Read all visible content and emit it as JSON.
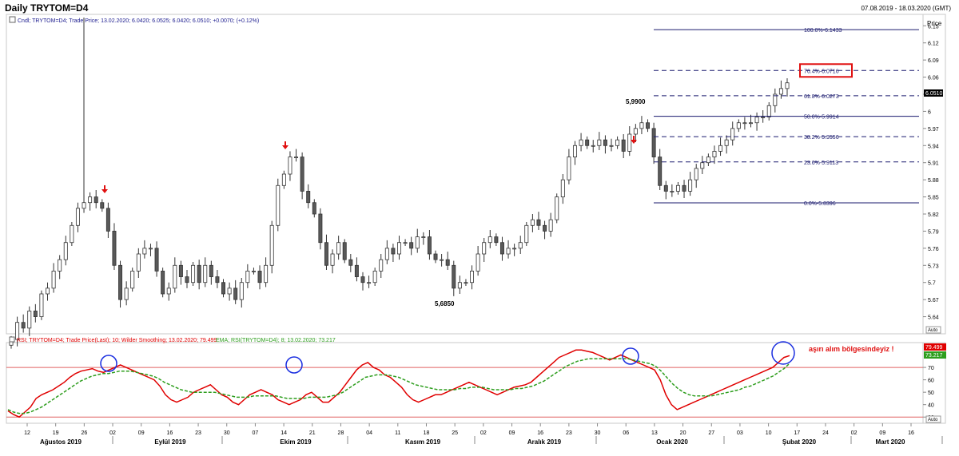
{
  "header": {
    "title": "Daily TRYTOM=D4",
    "date_range": "07.08.2019 - 18.03.2020 (GMT)"
  },
  "price_panel": {
    "legend": "Cndl; TRYTOM=D4; Trade Price; 13.02.2020; 6.0420; 6.0525; 6.0420; 6.0510; +0.0070; (+0.12%)",
    "axis_title": "Price",
    "last_price_tag": "6.0510",
    "auto_button": "Auto"
  },
  "rsi_panel": {
    "legend_rsi": "RSI; TRYTOM=D4; Trade Price(Last); 10; Wilder Smoothing; 13.02.2020; 79.499",
    "legend_ema": "EMA; RSI(TRYTOM=D4); 8; 13.02.2020; 73.217",
    "annotation": "aşırı alım bölgesindeyiz !",
    "rsi_tag": "79.499",
    "ema_tag": "73.217",
    "auto_button": "Auto"
  },
  "colors": {
    "up": "#ffffff",
    "down": "#595959",
    "rsi": "#e00000",
    "ema": "#2e9e1e",
    "fib": "#1a1a6e",
    "arrow": "#e01010",
    "circle": "#1a2ee0",
    "level": "#e06060"
  },
  "chart_data": [
    {
      "type": "candlestick",
      "title": "Daily TRYTOM=D4",
      "ylabel": "Price",
      "ylim": [
        5.61,
        6.17
      ],
      "y_ticks": [
        "6.15",
        "6.12",
        "6.09",
        "6.06",
        "6.03",
        "6",
        "5.97",
        "5.94",
        "5.91",
        "5.88",
        "5.85",
        "5.82",
        "5.79",
        "5.76",
        "5.73",
        "5.7",
        "5.67",
        "5.64"
      ],
      "x_ticks": [
        "12",
        "19",
        "26",
        "02",
        "09",
        "16",
        "23",
        "30",
        "07",
        "14",
        "21",
        "28",
        "04",
        "11",
        "18",
        "25",
        "02",
        "09",
        "16",
        "23",
        "30",
        "06",
        "13",
        "20",
        "27",
        "03",
        "10",
        "17",
        "24",
        "02",
        "09",
        "16"
      ],
      "month_labels": [
        "Ağustos 2019",
        "Eylül 2019",
        "Ekim 2019",
        "Kasım 2019",
        "Aralık 2019",
        "Ocak 2020",
        "Şubat 2020",
        "Mart 2020"
      ],
      "close_estimates": [
        5.6,
        5.63,
        5.62,
        5.65,
        5.64,
        5.68,
        5.69,
        5.72,
        5.74,
        5.77,
        5.8,
        5.83,
        5.84,
        5.85,
        5.84,
        5.83,
        5.79,
        5.73,
        5.67,
        5.69,
        5.72,
        5.75,
        5.76,
        5.76,
        5.72,
        5.68,
        5.69,
        5.73,
        5.71,
        5.7,
        5.73,
        5.7,
        5.73,
        5.71,
        5.7,
        5.68,
        5.69,
        5.67,
        5.7,
        5.72,
        5.72,
        5.7,
        5.73,
        5.8,
        5.87,
        5.89,
        5.92,
        5.92,
        5.86,
        5.84,
        5.82,
        5.77,
        5.73,
        5.75,
        5.77,
        5.74,
        5.73,
        5.71,
        5.7,
        5.7,
        5.72,
        5.74,
        5.76,
        5.75,
        5.77,
        5.77,
        5.76,
        5.78,
        5.78,
        5.75,
        5.74,
        5.74,
        5.73,
        5.69,
        5.7,
        5.7,
        5.72,
        5.75,
        5.77,
        5.78,
        5.77,
        5.75,
        5.76,
        5.76,
        5.77,
        5.8,
        5.81,
        5.8,
        5.79,
        5.81,
        5.85,
        5.88,
        5.92,
        5.94,
        5.95,
        5.94,
        5.94,
        5.95,
        5.94,
        5.94,
        5.95,
        5.93,
        5.96,
        5.97,
        5.98,
        5.97,
        5.92,
        5.87,
        5.86,
        5.86,
        5.87,
        5.86,
        5.88,
        5.9,
        5.91,
        5.92,
        5.93,
        5.94,
        5.95,
        5.97,
        5.98,
        5.98,
        5.98,
        5.99,
        5.99,
        6.01,
        6.03,
        6.04,
        6.05
      ],
      "annotations": [
        {
          "label": "5,9900",
          "price": 5.99
        },
        {
          "label": "5,6850",
          "price": 5.685
        }
      ],
      "fibonacci": [
        {
          "label": "100.0%-6.1433",
          "price": 6.1433,
          "style": "solid"
        },
        {
          "label": "76.4%-6.0716",
          "price": 6.0716,
          "style": "dashed",
          "highlight": true
        },
        {
          "label": "61.8%-6.0273",
          "price": 6.0273,
          "style": "dashed"
        },
        {
          "label": "50.0%-5.9914",
          "price": 5.9914,
          "style": "solid"
        },
        {
          "label": "38.2%-5.9556",
          "price": 5.9556,
          "style": "dashed"
        },
        {
          "label": "23.6%-5.9113",
          "price": 5.9113,
          "style": "dashed"
        },
        {
          "label": "0.0%-5.8396",
          "price": 5.8396,
          "style": "solid"
        }
      ]
    },
    {
      "type": "line",
      "ylim": [
        25,
        90
      ],
      "y_ticks": [
        "70",
        "60",
        "50",
        "40",
        "30"
      ],
      "levels": [
        70,
        30
      ],
      "series": [
        {
          "name": "RSI; TRYTOM=D4; Trade Price(Last); 10; Wilder Smoothing; 13.02.2020; 79.499",
          "values": [
            35,
            32,
            30,
            34,
            38,
            45,
            48,
            50,
            52,
            55,
            58,
            62,
            65,
            67,
            68,
            69,
            67,
            66,
            68,
            70,
            72,
            70,
            68,
            66,
            64,
            62,
            60,
            55,
            48,
            44,
            42,
            44,
            46,
            50,
            52,
            54,
            56,
            52,
            48,
            46,
            42,
            40,
            44,
            48,
            50,
            52,
            50,
            48,
            44,
            42,
            40,
            42,
            44,
            48,
            50,
            46,
            42,
            42,
            46,
            50,
            56,
            62,
            68,
            72,
            74,
            70,
            68,
            64,
            62,
            58,
            54,
            48,
            44,
            42,
            44,
            46,
            48,
            48,
            50,
            52,
            54,
            56,
            58,
            56,
            54,
            52,
            50,
            48,
            50,
            52,
            54,
            55,
            56,
            58,
            62,
            66,
            70,
            74,
            78,
            80,
            82,
            84,
            84,
            83,
            82,
            80,
            78,
            76,
            78,
            80,
            78,
            76,
            74,
            72,
            70,
            68,
            60,
            48,
            40,
            36,
            38,
            40,
            42,
            44,
            46,
            48,
            50,
            52,
            54,
            56,
            58,
            60,
            62,
            64,
            66,
            68,
            70,
            74,
            78,
            79.5
          ]
        },
        {
          "name": "EMA; RSI(TRYTOM=D4); 8; 13.02.2020; 73.217",
          "values": [
            36,
            34,
            33,
            33,
            34,
            36,
            38,
            41,
            44,
            47,
            50,
            53,
            56,
            59,
            61,
            63,
            64,
            65,
            65,
            66,
            67,
            67,
            67,
            66,
            65,
            64,
            63,
            61,
            58,
            56,
            54,
            52,
            51,
            50,
            50,
            50,
            50,
            50,
            49,
            48,
            47,
            46,
            46,
            46,
            47,
            47,
            47,
            47,
            47,
            46,
            45,
            45,
            45,
            45,
            46,
            46,
            46,
            46,
            47,
            48,
            50,
            53,
            56,
            59,
            62,
            63,
            64,
            64,
            64,
            63,
            62,
            60,
            58,
            56,
            55,
            54,
            53,
            52,
            52,
            52,
            52,
            53,
            53,
            54,
            54,
            54,
            53,
            52,
            52,
            52,
            52,
            53,
            53,
            54,
            55,
            57,
            59,
            62,
            65,
            68,
            71,
            73,
            75,
            76,
            77,
            77,
            77,
            77,
            77,
            77,
            77,
            77,
            76,
            75,
            74,
            73,
            71,
            67,
            62,
            57,
            53,
            50,
            48,
            47,
            47,
            47,
            47,
            48,
            49,
            50,
            51,
            52,
            54,
            55,
            57,
            59,
            61,
            63,
            66,
            69,
            73.2
          ]
        }
      ]
    }
  ]
}
